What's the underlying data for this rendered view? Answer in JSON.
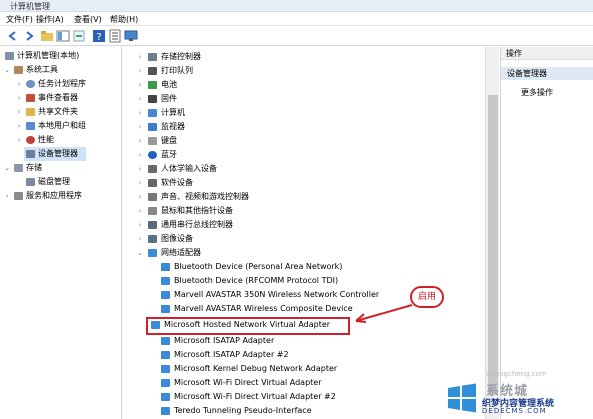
{
  "window": {
    "title": "计算机管理"
  },
  "menu": [
    {
      "label": "文件(F)"
    },
    {
      "label": "操作(A)"
    },
    {
      "label": "查看(V)"
    },
    {
      "label": "帮助(H)"
    }
  ],
  "toolbar": {
    "icons": [
      "back-icon",
      "forward-icon",
      "folder-icon",
      "view-icon",
      "refresh-icon",
      "help-icon",
      "properties-icon",
      "monitor-icon"
    ]
  },
  "left_tree": [
    {
      "label": "计算机管理(本地)",
      "icon": "computer-icon"
    },
    {
      "label": "系统工具",
      "icon": "tools-icon"
    },
    {
      "label": "任务计划程序",
      "icon": "clock-icon"
    },
    {
      "label": "事件查看器",
      "icon": "event-icon"
    },
    {
      "label": "共享文件夹",
      "icon": "folder-icon"
    },
    {
      "label": "本地用户和组",
      "icon": "users-icon"
    },
    {
      "label": "性能",
      "icon": "performance-icon"
    },
    {
      "label": "设备管理器",
      "icon": "device-manager-icon"
    },
    {
      "label": "存储",
      "icon": "storage-icon"
    },
    {
      "label": "磁盘管理",
      "icon": "disk-icon"
    },
    {
      "label": "服务和应用程序",
      "icon": "services-icon"
    }
  ],
  "device_categories": [
    {
      "label": "存储控制器",
      "icon": "storage-controller-icon"
    },
    {
      "label": "打印队列",
      "icon": "printer-icon"
    },
    {
      "label": "电池",
      "icon": "battery-icon"
    },
    {
      "label": "固件",
      "icon": "firmware-icon"
    },
    {
      "label": "计算机",
      "icon": "computer-icon"
    },
    {
      "label": "监视器",
      "icon": "monitor-icon"
    },
    {
      "label": "键盘",
      "icon": "keyboard-icon"
    },
    {
      "label": "蓝牙",
      "icon": "bluetooth-icon"
    },
    {
      "label": "人体学输入设备",
      "icon": "hid-icon"
    },
    {
      "label": "软件设备",
      "icon": "software-device-icon"
    },
    {
      "label": "声音、视频和游戏控制器",
      "icon": "sound-icon"
    },
    {
      "label": "鼠标和其他指针设备",
      "icon": "mouse-icon"
    },
    {
      "label": "通用串行总线控制器",
      "icon": "usb-icon"
    },
    {
      "label": "图像设备",
      "icon": "camera-icon"
    },
    {
      "label": "网络适配器",
      "icon": "network-icon"
    }
  ],
  "network_adapters": [
    {
      "label": "Bluetooth Device (Personal Area Network)"
    },
    {
      "label": "Bluetooth Device (RFCOMM Protocol TDI)"
    },
    {
      "label": "Marvell AVASTAR 350N Wireless Network Controller"
    },
    {
      "label": "Marvell AVASTAR Wireless Composite Device"
    },
    {
      "label": "Microsoft Hosted Network Virtual Adapter"
    },
    {
      "label": "Microsoft ISATAP Adapter"
    },
    {
      "label": "Microsoft ISATAP Adapter #2"
    },
    {
      "label": "Microsoft Kernel Debug Network Adapter"
    },
    {
      "label": "Microsoft Wi-Fi Direct Virtual Adapter"
    },
    {
      "label": "Microsoft Wi-Fi Direct Virtual Adapter #2"
    },
    {
      "label": "Teredo Tunneling Pseudo-Interface"
    }
  ],
  "actions": {
    "header": "操作",
    "selected": "设备管理器",
    "more": "更多操作"
  },
  "annotation": {
    "label": "启用",
    "color": "#d0202a"
  },
  "watermark": {
    "site_text": "xitongcheng.com",
    "brand": "系统城",
    "line1": "织梦内容管理系统",
    "line2": "DEDECMS.COM"
  }
}
